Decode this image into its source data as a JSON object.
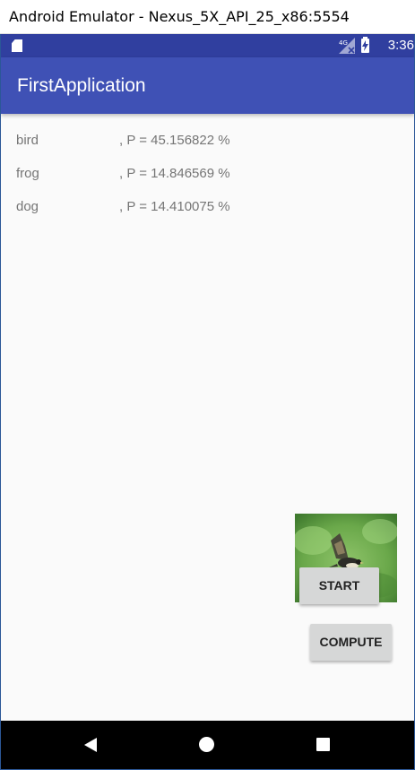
{
  "window": {
    "title": "Android Emulator - Nexus_5X_API_25_x86:5554"
  },
  "status_bar": {
    "time": "3:36",
    "network": "4G",
    "color": "#303f9f",
    "icons": [
      "sd-card-icon",
      "signal-icon",
      "battery-charging-icon"
    ]
  },
  "app_bar": {
    "title": "FirstApplication",
    "color": "#3f51b5"
  },
  "results": [
    {
      "label": "bird",
      "prob": ", P = 45.156822 %"
    },
    {
      "label": "frog",
      "prob": ", P = 14.846569 %"
    },
    {
      "label": "dog",
      "prob": ", P = 14.410075 %"
    }
  ],
  "image": {
    "subject": "bird-photo"
  },
  "buttons": {
    "start": "START",
    "compute": "COMPUTE"
  },
  "nav_bar": {
    "icons": [
      "back-icon",
      "home-icon",
      "recents-icon"
    ]
  }
}
